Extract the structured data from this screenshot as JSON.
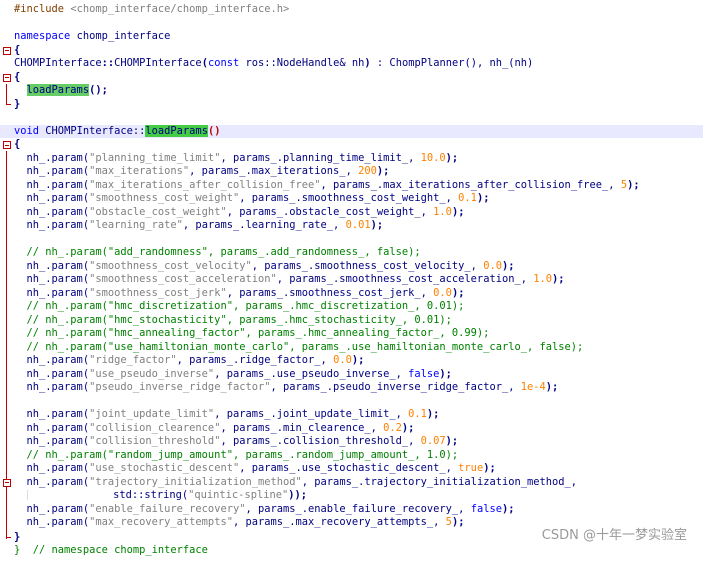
{
  "editor": {
    "include_directive": "#include",
    "include_path": "<chomp_interface/chomp_interface.h>",
    "kw_namespace": "namespace",
    "namespace_name": "chomp_interface",
    "ctor_class": "CHOMPInterface",
    "ctor_sep": "::",
    "ctor_name": "CHOMPInterface",
    "ctor_params": "(const ros::NodeHandle& nh)",
    "ctor_kw_const": "const",
    "ctor_type": "ros::NodeHandle&",
    "ctor_arg": "nh",
    "ctor_init": ": ChompPlanner(), nh_(nh)",
    "call_loadparams": "loadParams",
    "call_tail": "();",
    "kw_void": "void",
    "def_class": "CHOMPInterface::",
    "def_name": "loadParams",
    "def_parens": "()",
    "open_brace": "{",
    "close_brace": "}",
    "namespace_end_comment": "}  // namespace chomp_interface",
    "param_lines": [
      {
        "pre": "nh_.param(",
        "key": "\"planning_time_limit\"",
        "mid": ", params_.planning_time_limit_, ",
        "val": "10.0",
        "post": ");"
      },
      {
        "pre": "nh_.param(",
        "key": "\"max_iterations\"",
        "mid": ", params_.max_iterations_, ",
        "val": "200",
        "post": ");"
      },
      {
        "pre": "nh_.param(",
        "key": "\"max_iterations_after_collision_free\"",
        "mid": ", params_.max_iterations_after_collision_free_, ",
        "val": "5",
        "post": ");"
      },
      {
        "pre": "nh_.param(",
        "key": "\"smoothness_cost_weight\"",
        "mid": ", params_.smoothness_cost_weight_, ",
        "val": "0.1",
        "post": ");"
      },
      {
        "pre": "nh_.param(",
        "key": "\"obstacle_cost_weight\"",
        "mid": ", params_.obstacle_cost_weight_, ",
        "val": "1.0",
        "post": ");"
      },
      {
        "pre": "nh_.param(",
        "key": "\"learning_rate\"",
        "mid": ", params_.learning_rate_, ",
        "val": "0.01",
        "post": ");"
      }
    ],
    "comment_add_randomness": "// nh_.param(\"add_randomness\", params_.add_randomness_, false);",
    "param_lines_2": [
      {
        "pre": "nh_.param(",
        "key": "\"smoothness_cost_velocity\"",
        "mid": ", params_.smoothness_cost_velocity_, ",
        "val": "0.0",
        "post": ");"
      },
      {
        "pre": "nh_.param(",
        "key": "\"smoothness_cost_acceleration\"",
        "mid": ", params_.smoothness_cost_acceleration_, ",
        "val": "1.0",
        "post": ");"
      },
      {
        "pre": "nh_.param(",
        "key": "\"smoothness_cost_jerk\"",
        "mid": ", params_.smoothness_cost_jerk_, ",
        "val": "0.0",
        "post": ");"
      }
    ],
    "comment_hmc_1": "// nh_.param(\"hmc_discretization\", params_.hmc_discretization_, 0.01);",
    "comment_hmc_2": "// nh_.param(\"hmc_stochasticity\", params_.hmc_stochasticity_, 0.01);",
    "comment_hmc_3": "// nh_.param(\"hmc_annealing_factor\", params_.hmc_annealing_factor_, 0.99);",
    "comment_hmc_4": "// nh_.param(\"use_hamiltonian_monte_carlo\", params_.use_hamiltonian_monte_carlo_, false);",
    "param_lines_3": [
      {
        "pre": "nh_.param(",
        "key": "\"ridge_factor\"",
        "mid": ", params_.ridge_factor_, ",
        "val": "0.0",
        "post": ");"
      },
      {
        "pre": "nh_.param(",
        "key": "\"use_pseudo_inverse\"",
        "mid": ", params_.use_pseudo_inverse_, ",
        "val": "false",
        "post": ");",
        "kwval": true
      },
      {
        "pre": "nh_.param(",
        "key": "\"pseudo_inverse_ridge_factor\"",
        "mid": ", params_.pseudo_inverse_ridge_factor_, ",
        "val": "1e-4",
        "post": ");"
      }
    ],
    "param_lines_4": [
      {
        "pre": "nh_.param(",
        "key": "\"joint_update_limit\"",
        "mid": ", params_.joint_update_limit_, ",
        "val": "0.1",
        "post": ");"
      },
      {
        "pre": "nh_.param(",
        "key": "\"collision_clearence\"",
        "mid": ", params_.min_clearence_, ",
        "val": "0.2",
        "post": ");"
      },
      {
        "pre": "nh_.param(",
        "key": "\"collision_threshold\"",
        "mid": ", params_.collision_threshold_, ",
        "val": "0.07",
        "post": ");"
      }
    ],
    "comment_random_jump": "// nh_.param(\"random_jump_amount\", params_.random_jump_amount_, 1.0);",
    "stochastic_line": {
      "pre": "nh_.param(",
      "key": "\"use_stochastic_descent\"",
      "mid": ", params_.use_stochastic_descent_, ",
      "val": "true",
      "post": ");"
    },
    "traj_line_1": {
      "pre": "nh_.param(",
      "key": "\"trajectory_initialization_method\"",
      "mid": ", params_.trajectory_initialization_method_,"
    },
    "traj_line_2": {
      "pre": "std::string(",
      "key": "\"quintic-spline\"",
      "post": "));"
    },
    "param_lines_5": [
      {
        "pre": "nh_.param(",
        "key": "\"enable_failure_recovery\"",
        "mid": ", params_.enable_failure_recovery_, ",
        "val": "false",
        "post": ");",
        "kwval": true
      },
      {
        "pre": "nh_.param(",
        "key": "\"max_recovery_attempts\"",
        "mid": ", params_.max_recovery_attempts_, ",
        "val": "5",
        "post": ");"
      }
    ]
  },
  "watermark": "CSDN @十年一梦实验室"
}
